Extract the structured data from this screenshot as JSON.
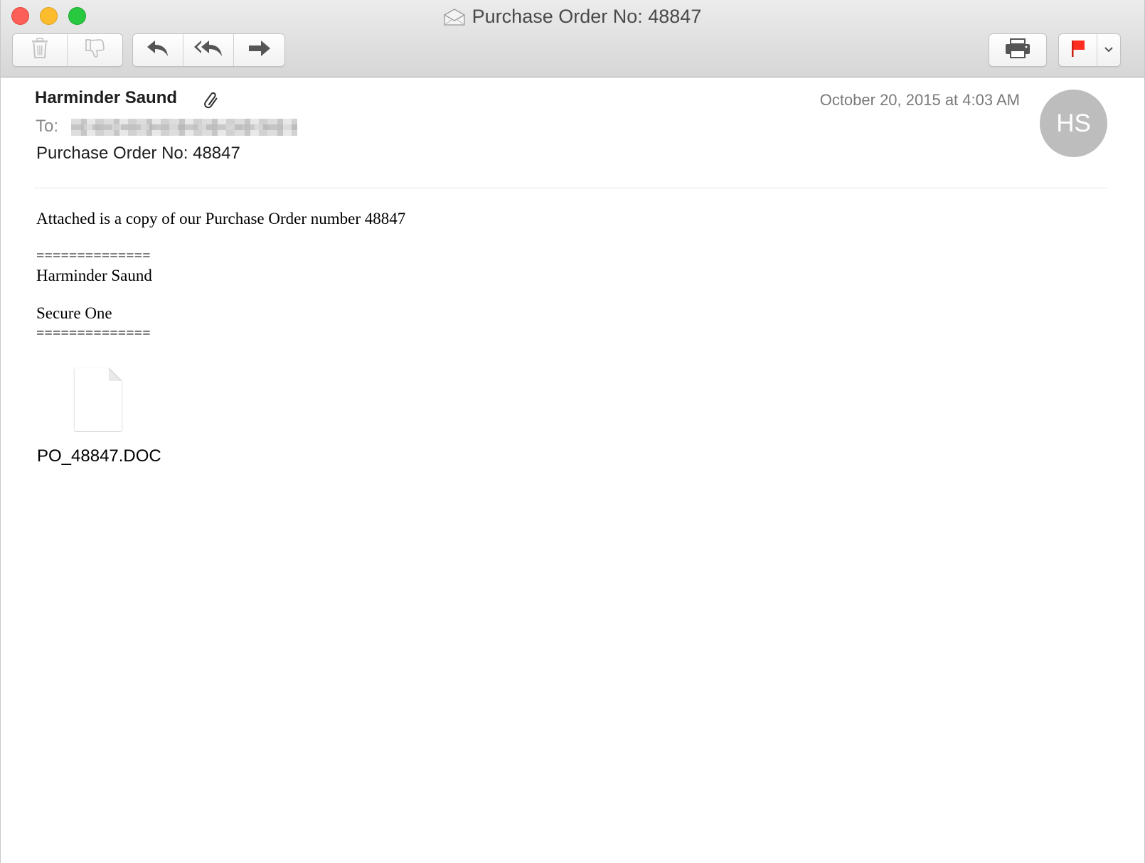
{
  "window": {
    "title": "Purchase Order No: 48847"
  },
  "toolbar": {
    "delete_icon": "trash-icon",
    "junk_icon": "thumbs-down-icon",
    "reply_icon": "reply-arrow-icon",
    "reply_all_icon": "reply-all-arrow-icon",
    "forward_icon": "forward-arrow-icon",
    "print_icon": "printer-icon",
    "flag_icon": "flag-icon",
    "flag_color": "#ff2d20"
  },
  "message": {
    "sender": "Harminder Saund",
    "to_label": "To:",
    "date": "October 20, 2015 at 4:03 AM",
    "avatar_initials": "HS",
    "subject": "Purchase Order No: 48847",
    "body": {
      "line1": "Attached is a copy of our Purchase Order number 48847",
      "separator_top": "==============",
      "signature_name": "Harminder Saund",
      "signature_company": "Secure One",
      "separator_bottom": "=============="
    },
    "attachment": {
      "filename": "PO_48847.DOC"
    }
  }
}
